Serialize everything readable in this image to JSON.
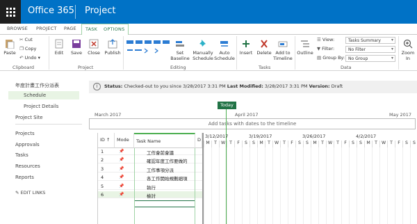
{
  "suite": {
    "brand": "Office 365",
    "app": "Project"
  },
  "tabs": [
    "BROWSE",
    "PROJECT",
    "PAGE",
    "TASK",
    "OPTIONS"
  ],
  "ribbon": {
    "clipboard": {
      "paste": "Paste",
      "cut": "Cut",
      "copy": "Copy",
      "undo": "Undo",
      "label": "Clipboard"
    },
    "project": {
      "edit": "Edit",
      "save": "Save",
      "close": "Close",
      "publish": "Publish",
      "label": "Project"
    },
    "editing": {
      "set_baseline": "Set Baseline",
      "manually_schedule": "Manually Schedule",
      "auto_schedule": "Auto Schedule",
      "label": "Editing"
    },
    "tasks": {
      "insert": "Insert",
      "delete": "Delete",
      "add_to_timeline": "Add to Timeline",
      "label": "Tasks"
    },
    "data": {
      "outline": "Outline",
      "view_label": "View:",
      "view_value": "Tasks Summary",
      "filter_label": "Filter:",
      "filter_value": "No Filter",
      "group_label": "Group By:",
      "group_value": "No Group",
      "label": "Data"
    },
    "zoom": "Zoom In"
  },
  "nav": {
    "project_name": "年度計畫工作分派表",
    "schedule": "Schedule",
    "project_details": "Project Details",
    "project_site": "Project Site",
    "projects": "Projects",
    "approvals": "Approvals",
    "tasks": "Tasks",
    "resources": "Resources",
    "reports": "Reports",
    "edit_links": "EDIT LINKS"
  },
  "status": {
    "label": "Status:",
    "text": "Checked-out to you since 3/28/2017 3:31 PM",
    "lm_label": "Last Modified:",
    "lm_value": "3/28/2017 3:31 PM",
    "ver_label": "Version:",
    "ver_value": "Draft"
  },
  "timeline": {
    "today": "Today",
    "months": [
      "March 2017",
      "April 2017",
      "May 2017"
    ],
    "placeholder": "Add tasks with dates to the timeline"
  },
  "grid": {
    "headers": {
      "id": "ID ↑",
      "mode": "Mode",
      "name": "Task Name",
      "d": "D"
    },
    "rows": [
      {
        "id": "1",
        "name": "工作會前會議"
      },
      {
        "id": "2",
        "name": "確認年度工作要做的"
      },
      {
        "id": "3",
        "name": "工作事項分派"
      },
      {
        "id": "4",
        "name": "各工作開始規劃細項"
      },
      {
        "id": "5",
        "name": "執行"
      },
      {
        "id": "6",
        "name": "檢討"
      }
    ]
  },
  "gantt": {
    "weeks": [
      "3/12/2017",
      "3/19/2017",
      "3/26/2017",
      "4/2/2017"
    ],
    "days": [
      "M",
      "T",
      "W",
      "T",
      "F",
      "S",
      "S"
    ]
  }
}
